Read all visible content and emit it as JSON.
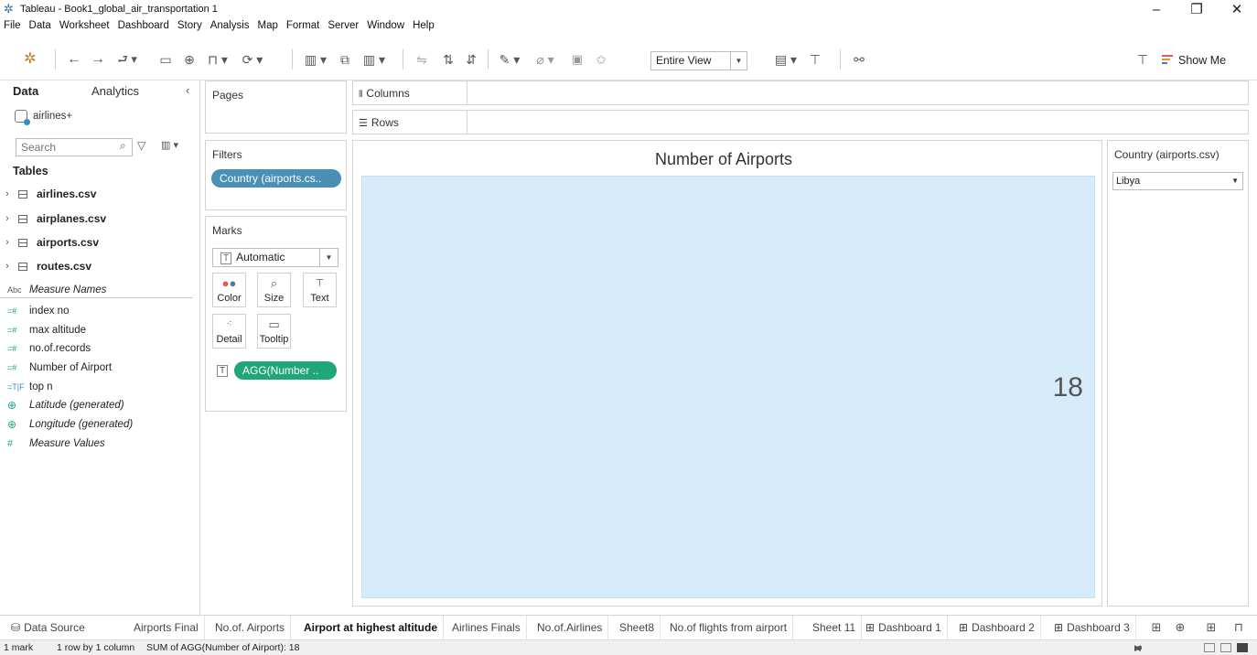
{
  "window": {
    "title": "Tableau - Book1_global_air_transportation 1",
    "minimize": "–",
    "restore": "❐",
    "close": "✕"
  },
  "menu": [
    "File",
    "Data",
    "Worksheet",
    "Dashboard",
    "Story",
    "Analysis",
    "Map",
    "Format",
    "Server",
    "Window",
    "Help"
  ],
  "toolbar": {
    "fit_value": "Entire View",
    "show_me": "Show Me"
  },
  "data_pane": {
    "tab_data": "Data",
    "tab_analytics": "Analytics",
    "datasource": "airlines+",
    "search_placeholder": "Search",
    "tables_header": "Tables",
    "tables": [
      "airlines.csv",
      "airplanes.csv",
      "airports.csv",
      "routes.csv"
    ],
    "fields": [
      {
        "icon": "Abc",
        "label": "Measure Names",
        "italic": true
      },
      {
        "icon": "=#",
        "label": "index no",
        "italic": false
      },
      {
        "icon": "=#",
        "label": "max altitude",
        "italic": false
      },
      {
        "icon": "=#",
        "label": "no.of.records",
        "italic": false
      },
      {
        "icon": "=#",
        "label": "Number of Airport",
        "italic": false
      },
      {
        "icon": "=T|F",
        "label": "top n",
        "italic": false
      },
      {
        "icon": "⊕",
        "label": "Latitude (generated)",
        "italic": true
      },
      {
        "icon": "⊕",
        "label": "Longitude (generated)",
        "italic": true
      },
      {
        "icon": "#",
        "label": "Measure Values",
        "italic": true
      }
    ]
  },
  "pages": {
    "title": "Pages"
  },
  "filters": {
    "title": "Filters",
    "pill": "Country (airports.cs.."
  },
  "marks": {
    "title": "Marks",
    "type": "Automatic",
    "buttons": {
      "color": "Color",
      "size": "Size",
      "text": "Text",
      "detail": "Detail",
      "tooltip": "Tooltip"
    },
    "pill": "AGG(Number .."
  },
  "shelves": {
    "columns": "Columns",
    "rows": "Rows"
  },
  "viz": {
    "title": "Number of Airports",
    "value": "18"
  },
  "quick_filter": {
    "title": "Country (airports.csv)",
    "value": "Libya"
  },
  "sheet_tabs": {
    "data_source": "Data Source",
    "tabs": [
      "Airports Final",
      "No.of. Airports",
      "Airport at highest altitude",
      "Airlines Finals",
      "No.of.Airlines",
      "Sheet8",
      "No.of flights from airport",
      "Sheet 11",
      "Dashboard 1",
      "Dashboard 2",
      "Dashboard 3"
    ],
    "active_index": 2
  },
  "status": {
    "marks": "1 mark",
    "dims": "1 row by 1 column",
    "summary": "SUM of AGG(Number of Airport): 18"
  }
}
